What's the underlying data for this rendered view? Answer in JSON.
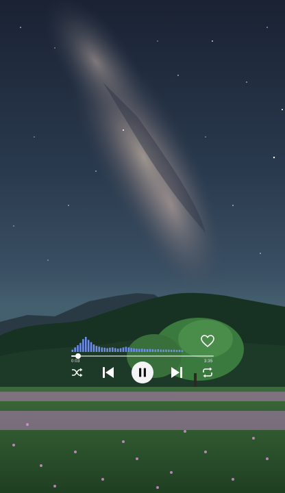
{
  "wallpaper": "milky-way-night-sky-over-hills-with-tree-and-pink-flower-meadow",
  "visualizer": {
    "levels": [
      0.15,
      0.3,
      0.45,
      0.6,
      0.85,
      1.0,
      0.8,
      0.65,
      0.5,
      0.4,
      0.35,
      0.3,
      0.28,
      0.25,
      0.28,
      0.3,
      0.26,
      0.22,
      0.25,
      0.3,
      0.34,
      0.3,
      0.26,
      0.24,
      0.22,
      0.2,
      0.22,
      0.2,
      0.18,
      0.2,
      0.18,
      0.16,
      0.18,
      0.16,
      0.15,
      0.16,
      0.15,
      0.14,
      0.15,
      0.13,
      0.14,
      0.12
    ],
    "color": "#6f8df0"
  },
  "player": {
    "progress": 0.05,
    "elapsed": "0:03",
    "duration": "3:35",
    "liked": false,
    "state": "playing",
    "accent": "#ffffff"
  },
  "icons": {
    "shuffle": "shuffle-icon",
    "previous": "skip-previous-icon",
    "play_pause": "pause-icon",
    "next": "skip-next-icon",
    "repeat": "repeat-icon",
    "like": "heart-icon"
  }
}
